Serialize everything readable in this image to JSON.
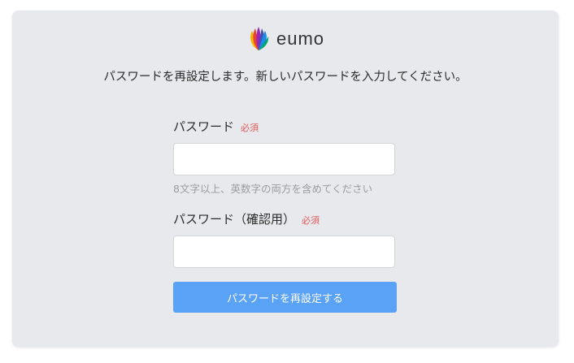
{
  "brand": {
    "logo_text": "eumo",
    "petal_colors": [
      "#f4b400",
      "#ea4335",
      "#9c27b0",
      "#3f51b5",
      "#1e88e5",
      "#00a86b"
    ]
  },
  "intro_text": "パスワードを再設定します。新しいパスワードを入力してください。",
  "password": {
    "label": "パスワード",
    "required_label": "必須",
    "value": "",
    "placeholder": "",
    "hint": "8文字以上、英数字の両方を含めてください"
  },
  "password_confirm": {
    "label": "パスワード（確認用）",
    "required_label": "必須",
    "value": "",
    "placeholder": ""
  },
  "submit_label": "パスワードを再設定する",
  "colors": {
    "card_bg": "#e8e9ec",
    "accent": "#5aa2f5",
    "required": "#e05a5a"
  }
}
